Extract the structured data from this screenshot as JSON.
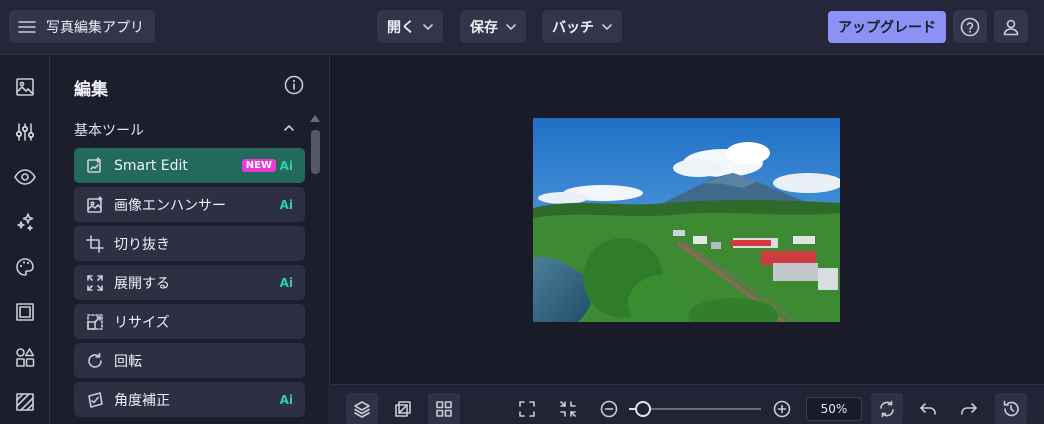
{
  "app": {
    "title": "写真編集アプリ"
  },
  "menu": {
    "open": "開く",
    "save": "保存",
    "batch": "バッチ"
  },
  "upgrade": "アップグレード",
  "rail": [
    {
      "icon": "image-icon"
    },
    {
      "icon": "sliders-icon"
    },
    {
      "icon": "eye-icon"
    },
    {
      "icon": "sparkle-icon"
    },
    {
      "icon": "palette-icon"
    },
    {
      "icon": "frame-icon"
    },
    {
      "icon": "shapes-icon"
    },
    {
      "icon": "texture-icon"
    }
  ],
  "panel": {
    "title": "編集",
    "section": "基本ツール",
    "tools": [
      {
        "name": "Smart Edit",
        "badge": "NEW",
        "ai": "Ai",
        "icon": "smart-edit-icon"
      },
      {
        "name": "画像エンハンサー",
        "ai": "Ai",
        "icon": "enhancer-icon"
      },
      {
        "name": "切り抜き",
        "icon": "crop-icon"
      },
      {
        "name": "展開する",
        "ai": "Ai",
        "icon": "expand-icon"
      },
      {
        "name": "リサイズ",
        "icon": "resize-icon"
      },
      {
        "name": "回転",
        "icon": "rotate-icon"
      },
      {
        "name": "角度補正",
        "ai": "Ai",
        "icon": "straighten-icon"
      }
    ]
  },
  "zoom": {
    "value": "50%",
    "level": 0.12
  },
  "colors": {
    "accent": "#8a93f5",
    "active_tool": "#246a5c",
    "ai": "#2fd0a8",
    "new_badge": "#e93ad7"
  }
}
